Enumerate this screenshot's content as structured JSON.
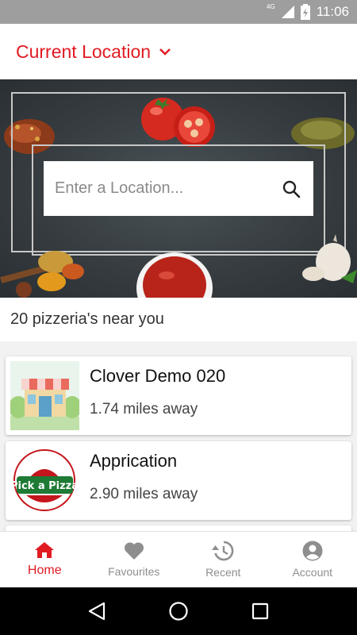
{
  "status_bar": {
    "network": "4G",
    "time": "11:06"
  },
  "app_bar": {
    "title": "Current Location"
  },
  "search": {
    "placeholder": "Enter a Location..."
  },
  "list": {
    "header": "20 pizzeria's near you",
    "items": [
      {
        "name": "Clover Demo 020",
        "distance": "1.74 miles away",
        "thumbnail": "storefront-illustration"
      },
      {
        "name": "Apprication",
        "distance": "2.90 miles away",
        "thumbnail": "pick-a-pizza-logo"
      }
    ]
  },
  "bottom_nav": {
    "items": [
      {
        "label": "Home",
        "icon": "home-icon",
        "active": true
      },
      {
        "label": "Favourites",
        "icon": "heart-icon",
        "active": false
      },
      {
        "label": "Recent",
        "icon": "history-icon",
        "active": false
      },
      {
        "label": "Account",
        "icon": "account-icon",
        "active": false
      }
    ]
  },
  "colors": {
    "accent": "#e01b22",
    "inactive": "#8e8e8e",
    "status_bar": "#9e9e9e"
  }
}
